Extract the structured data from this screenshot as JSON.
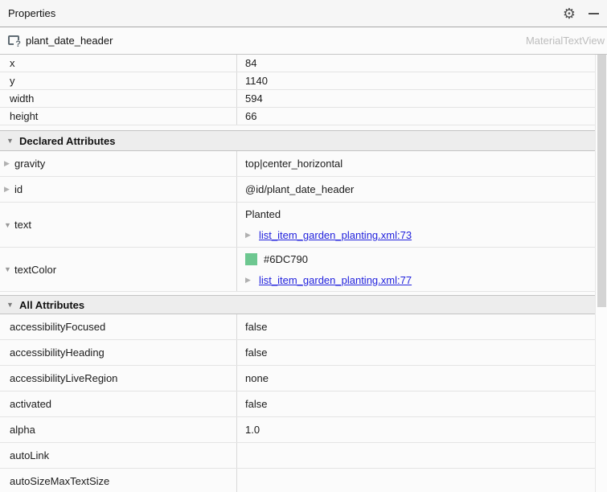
{
  "panel": {
    "title": "Properties"
  },
  "icons": {
    "gear": "⚙",
    "component_unknown": "?",
    "section_open": "▼",
    "row_closed": "▶",
    "row_open": "▼",
    "link_arrow": "▶"
  },
  "component": {
    "id": "plant_date_header",
    "type": "MaterialTextView"
  },
  "layout_rows": [
    {
      "label": "x",
      "value": "84"
    },
    {
      "label": "y",
      "value": "1140"
    },
    {
      "label": "width",
      "value": "594"
    },
    {
      "label": "height",
      "value": "66"
    }
  ],
  "declared": {
    "title": "Declared Attributes",
    "rows": [
      {
        "label": "gravity",
        "value": "top|center_horizontal"
      },
      {
        "label": "id",
        "value": "@id/plant_date_header"
      },
      {
        "label": "text",
        "value": "Planted",
        "link": "list_item_garden_planting.xml:73"
      },
      {
        "label": "textColor",
        "value": "#6DC790",
        "swatch_style": "background:#6DC790",
        "link": "list_item_garden_planting.xml:77"
      }
    ]
  },
  "all": {
    "title": "All Attributes",
    "rows": [
      {
        "label": "accessibilityFocused",
        "value": "false"
      },
      {
        "label": "accessibilityHeading",
        "value": "false"
      },
      {
        "label": "accessibilityLiveRegion",
        "value": "none"
      },
      {
        "label": "activated",
        "value": "false"
      },
      {
        "label": "alpha",
        "value": "1.0"
      },
      {
        "label": "autoLink",
        "value": ""
      },
      {
        "label": "autoSizeMaxTextSize",
        "value": ""
      }
    ]
  },
  "colors": {
    "swatch_green": "#6DC790",
    "link_blue": "#2222DD"
  }
}
